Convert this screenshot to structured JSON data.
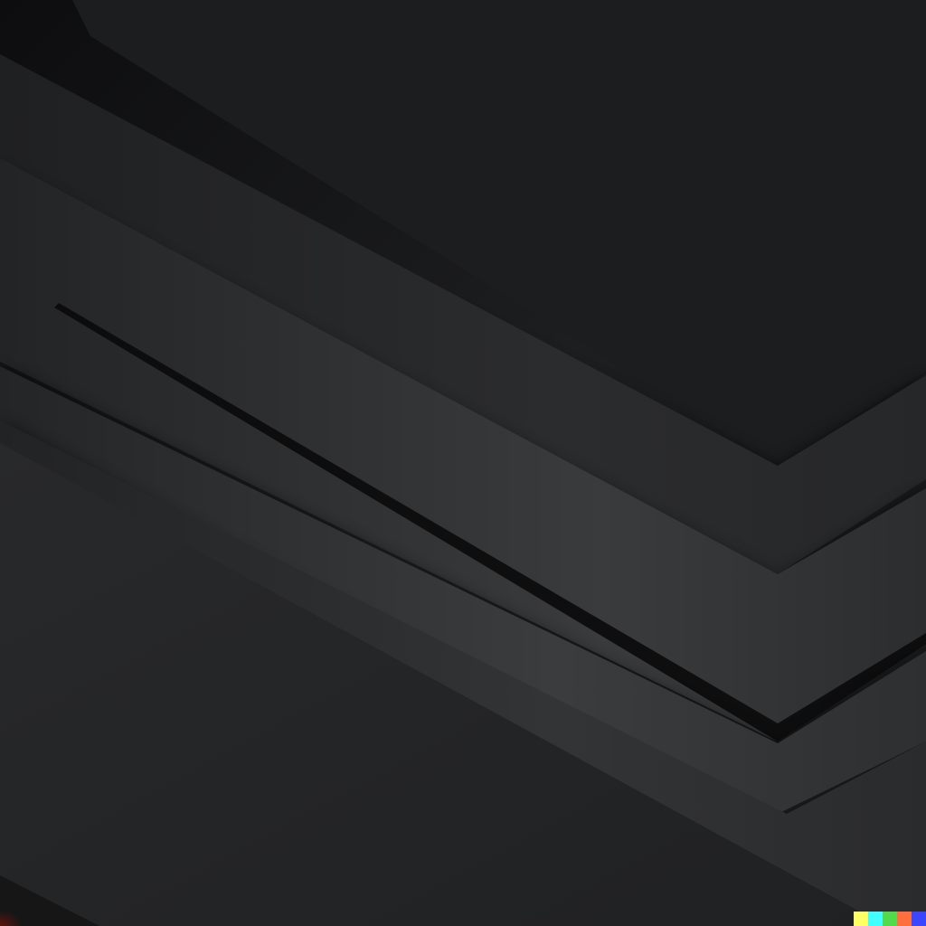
{
  "palette": {
    "background": "#1b1c1e",
    "band_dark": "#1e1f21",
    "band_mid": "#2a2b2d",
    "band_light": "#3a3b3d",
    "shadow": "#050506",
    "accent_red": "#b81a08"
  },
  "swatches": [
    {
      "name": "yellow-swatch",
      "color": "#ffff66"
    },
    {
      "name": "cyan-swatch",
      "color": "#42ffff"
    },
    {
      "name": "green-swatch",
      "color": "#51da4c"
    },
    {
      "name": "orange-swatch",
      "color": "#ff6e3c"
    },
    {
      "name": "blue-swatch",
      "color": "#3c46ff"
    }
  ]
}
